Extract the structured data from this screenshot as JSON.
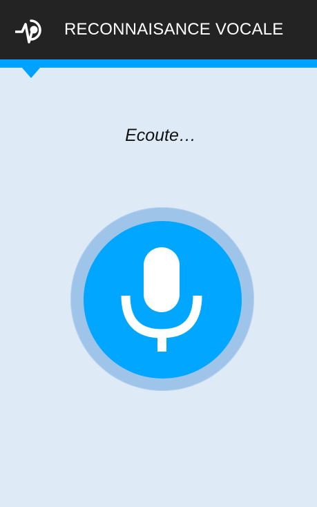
{
  "header": {
    "title": "RECONNAISANCE VOCALE",
    "icon": "pulse-play-icon"
  },
  "main": {
    "status": "Ecoute…",
    "microphone_icon": "microphone-icon"
  },
  "colors": {
    "header_background": "#232323",
    "accent": "#00a2ff",
    "page_background": "#dfeaf7",
    "mic_ring": "#9fc4e9",
    "mic_core": "#00a6ff"
  }
}
